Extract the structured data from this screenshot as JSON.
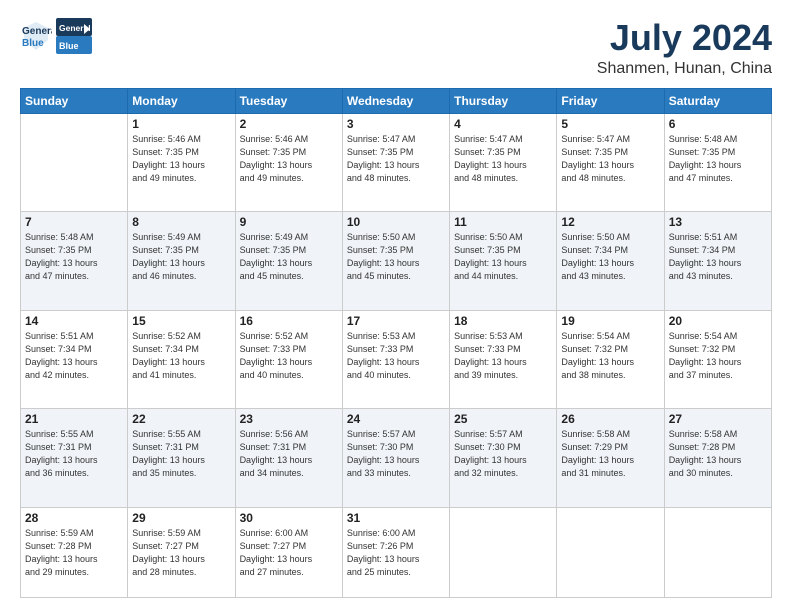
{
  "header": {
    "logo_line1": "General",
    "logo_line2": "Blue",
    "month": "July 2024",
    "location": "Shanmen, Hunan, China"
  },
  "days_of_week": [
    "Sunday",
    "Monday",
    "Tuesday",
    "Wednesday",
    "Thursday",
    "Friday",
    "Saturday"
  ],
  "weeks": [
    [
      {
        "day": "",
        "info": ""
      },
      {
        "day": "1",
        "info": "Sunrise: 5:46 AM\nSunset: 7:35 PM\nDaylight: 13 hours\nand 49 minutes."
      },
      {
        "day": "2",
        "info": "Sunrise: 5:46 AM\nSunset: 7:35 PM\nDaylight: 13 hours\nand 49 minutes."
      },
      {
        "day": "3",
        "info": "Sunrise: 5:47 AM\nSunset: 7:35 PM\nDaylight: 13 hours\nand 48 minutes."
      },
      {
        "day": "4",
        "info": "Sunrise: 5:47 AM\nSunset: 7:35 PM\nDaylight: 13 hours\nand 48 minutes."
      },
      {
        "day": "5",
        "info": "Sunrise: 5:47 AM\nSunset: 7:35 PM\nDaylight: 13 hours\nand 48 minutes."
      },
      {
        "day": "6",
        "info": "Sunrise: 5:48 AM\nSunset: 7:35 PM\nDaylight: 13 hours\nand 47 minutes."
      }
    ],
    [
      {
        "day": "7",
        "info": "Sunrise: 5:48 AM\nSunset: 7:35 PM\nDaylight: 13 hours\nand 47 minutes."
      },
      {
        "day": "8",
        "info": "Sunrise: 5:49 AM\nSunset: 7:35 PM\nDaylight: 13 hours\nand 46 minutes."
      },
      {
        "day": "9",
        "info": "Sunrise: 5:49 AM\nSunset: 7:35 PM\nDaylight: 13 hours\nand 45 minutes."
      },
      {
        "day": "10",
        "info": "Sunrise: 5:50 AM\nSunset: 7:35 PM\nDaylight: 13 hours\nand 45 minutes."
      },
      {
        "day": "11",
        "info": "Sunrise: 5:50 AM\nSunset: 7:35 PM\nDaylight: 13 hours\nand 44 minutes."
      },
      {
        "day": "12",
        "info": "Sunrise: 5:50 AM\nSunset: 7:34 PM\nDaylight: 13 hours\nand 43 minutes."
      },
      {
        "day": "13",
        "info": "Sunrise: 5:51 AM\nSunset: 7:34 PM\nDaylight: 13 hours\nand 43 minutes."
      }
    ],
    [
      {
        "day": "14",
        "info": "Sunrise: 5:51 AM\nSunset: 7:34 PM\nDaylight: 13 hours\nand 42 minutes."
      },
      {
        "day": "15",
        "info": "Sunrise: 5:52 AM\nSunset: 7:34 PM\nDaylight: 13 hours\nand 41 minutes."
      },
      {
        "day": "16",
        "info": "Sunrise: 5:52 AM\nSunset: 7:33 PM\nDaylight: 13 hours\nand 40 minutes."
      },
      {
        "day": "17",
        "info": "Sunrise: 5:53 AM\nSunset: 7:33 PM\nDaylight: 13 hours\nand 40 minutes."
      },
      {
        "day": "18",
        "info": "Sunrise: 5:53 AM\nSunset: 7:33 PM\nDaylight: 13 hours\nand 39 minutes."
      },
      {
        "day": "19",
        "info": "Sunrise: 5:54 AM\nSunset: 7:32 PM\nDaylight: 13 hours\nand 38 minutes."
      },
      {
        "day": "20",
        "info": "Sunrise: 5:54 AM\nSunset: 7:32 PM\nDaylight: 13 hours\nand 37 minutes."
      }
    ],
    [
      {
        "day": "21",
        "info": "Sunrise: 5:55 AM\nSunset: 7:31 PM\nDaylight: 13 hours\nand 36 minutes."
      },
      {
        "day": "22",
        "info": "Sunrise: 5:55 AM\nSunset: 7:31 PM\nDaylight: 13 hours\nand 35 minutes."
      },
      {
        "day": "23",
        "info": "Sunrise: 5:56 AM\nSunset: 7:31 PM\nDaylight: 13 hours\nand 34 minutes."
      },
      {
        "day": "24",
        "info": "Sunrise: 5:57 AM\nSunset: 7:30 PM\nDaylight: 13 hours\nand 33 minutes."
      },
      {
        "day": "25",
        "info": "Sunrise: 5:57 AM\nSunset: 7:30 PM\nDaylight: 13 hours\nand 32 minutes."
      },
      {
        "day": "26",
        "info": "Sunrise: 5:58 AM\nSunset: 7:29 PM\nDaylight: 13 hours\nand 31 minutes."
      },
      {
        "day": "27",
        "info": "Sunrise: 5:58 AM\nSunset: 7:28 PM\nDaylight: 13 hours\nand 30 minutes."
      }
    ],
    [
      {
        "day": "28",
        "info": "Sunrise: 5:59 AM\nSunset: 7:28 PM\nDaylight: 13 hours\nand 29 minutes."
      },
      {
        "day": "29",
        "info": "Sunrise: 5:59 AM\nSunset: 7:27 PM\nDaylight: 13 hours\nand 28 minutes."
      },
      {
        "day": "30",
        "info": "Sunrise: 6:00 AM\nSunset: 7:27 PM\nDaylight: 13 hours\nand 27 minutes."
      },
      {
        "day": "31",
        "info": "Sunrise: 6:00 AM\nSunset: 7:26 PM\nDaylight: 13 hours\nand 25 minutes."
      },
      {
        "day": "",
        "info": ""
      },
      {
        "day": "",
        "info": ""
      },
      {
        "day": "",
        "info": ""
      }
    ]
  ]
}
